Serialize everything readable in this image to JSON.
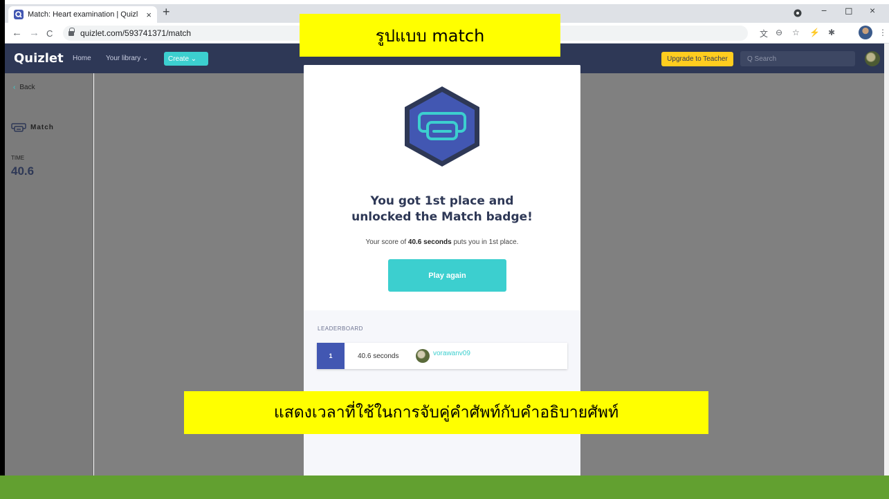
{
  "browser": {
    "tab_title": "Match: Heart examination | Quizl",
    "tab_close": "×",
    "new_tab": "+",
    "url": "quizlet.com/593741371/match",
    "nav": {
      "back": "←",
      "forward": "→",
      "reload": "C"
    },
    "window_controls": {
      "minimize": "−",
      "maximize": "◻",
      "close": "×"
    }
  },
  "quizlet_nav": {
    "logo": "Quizlet",
    "home": "Home",
    "your_library": "Your library ⌄",
    "create": "Create ⌄",
    "upgrade": "Upgrade to Teacher",
    "search_placeholder": "Q  Search"
  },
  "sidebar": {
    "back_chevron": "‹",
    "back": "Back",
    "mode": "Match",
    "time_label": "TIME",
    "time_value": "40.6"
  },
  "result": {
    "headline_line1": "You got 1st place and",
    "headline_line2": "unlocked the Match badge!",
    "score_prefix": "Your score of ",
    "score_value": "40.6 seconds",
    "score_suffix": " puts you in 1st place.",
    "play_again": "Play again"
  },
  "leaderboard": {
    "label": "LEADERBOARD",
    "rows": [
      {
        "rank": "1",
        "time": "40.6 seconds",
        "user": "vorawanv09"
      }
    ]
  },
  "callouts": {
    "top": "รูปแบบ match",
    "bottom": "แสดงเวลาที่ใช้ในการจับคู่คำศัพท์กับคำอธิบายศัพท์"
  },
  "colors": {
    "quizlet_nav": "#2e3856",
    "teal": "#3ccfcf",
    "badge_blue": "#4257b2",
    "upgrade_yellow": "#ffcd1f",
    "callout_yellow": "#ffff00",
    "footer_green": "#62a030"
  }
}
